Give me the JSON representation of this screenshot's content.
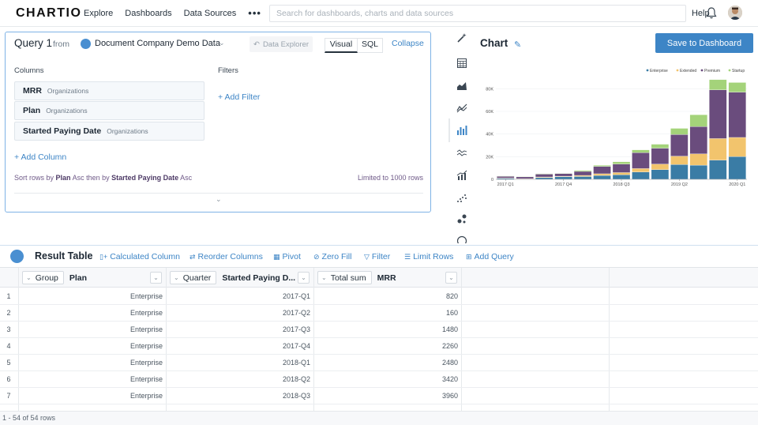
{
  "app": {
    "logo": "CHARTIO"
  },
  "nav": {
    "explore": "Explore",
    "dashboards": "Dashboards",
    "data_sources": "Data Sources",
    "more": "•••",
    "help": "Help"
  },
  "search": {
    "placeholder": "Search for dashboards, charts and data sources",
    "value": ""
  },
  "query": {
    "title": "Query 1",
    "from_label": "from",
    "data_source": "Document Company Demo Data",
    "explorer_label": "Data Explorer",
    "tabs": [
      "Visual",
      "SQL"
    ],
    "collapse_label": "Collapse",
    "columns_label": "Columns",
    "filters_label": "Filters",
    "columns": [
      {
        "name": "MRR",
        "source": "Organizations"
      },
      {
        "name": "Plan",
        "source": "Organizations"
      },
      {
        "name": "Started Paying Date",
        "source": "Organizations"
      }
    ],
    "add_column": "+ Add Column",
    "add_filter": "+ Add Filter",
    "sort_prefix": "Sort rows by",
    "sort_field_1": "Plan",
    "sort_dir_1": "Asc then by",
    "sort_field_2": "Started Paying Date",
    "sort_dir_2": "Asc",
    "limit_text": "Limited to 1000 rows"
  },
  "chart_panel": {
    "title": "Chart",
    "save_button": "Save to Dashboard"
  },
  "chart_data": {
    "type": "bar",
    "stacked": true,
    "categories": [
      "2017-Q1",
      "2017-Q2",
      "2017-Q3",
      "2017-Q4",
      "2018-Q1",
      "2018-Q2",
      "2018-Q3",
      "2018-Q4",
      "2019-Q1",
      "2019-Q2",
      "2019-Q3",
      "2019-Q4",
      "2020-Q1"
    ],
    "tick_labels": [
      "2017 Q1",
      "2017 Q4",
      "2018 Q3",
      "2019 Q2",
      "2020 Q1"
    ],
    "y_ticks": [
      "0",
      "20K",
      "40K",
      "60K",
      "80K"
    ],
    "ylim": [
      0,
      90000
    ],
    "legend_position": "top-right",
    "series": [
      {
        "name": "Enterprise",
        "color": "#3a7ca5",
        "values": [
          820,
          160,
          1480,
          2260,
          2480,
          3420,
          3960,
          6500,
          8500,
          13000,
          12500,
          17000,
          20000
        ]
      },
      {
        "name": "Extended",
        "color": "#f2c46d",
        "values": [
          300,
          400,
          600,
          500,
          1000,
          1500,
          2000,
          3000,
          5000,
          7500,
          10000,
          19000,
          17000
        ]
      },
      {
        "name": "Premium",
        "color": "#6a4c7d",
        "values": [
          1500,
          1600,
          2500,
          2300,
          3500,
          6500,
          7500,
          14000,
          14000,
          19000,
          24000,
          43000,
          40000
        ]
      },
      {
        "name": "Startup",
        "color": "#a4d37a",
        "values": [
          300,
          300,
          400,
          300,
          800,
          1000,
          2000,
          2500,
          3500,
          5500,
          10500,
          9000,
          8500
        ]
      }
    ]
  },
  "result_table": {
    "title": "Result Table",
    "tools": [
      "Calculated Column",
      "Reorder Columns",
      "Pivot",
      "Zero Fill",
      "Filter",
      "Limit Rows",
      "Add Query"
    ],
    "headers": [
      {
        "agg": "Group",
        "name": "Plan"
      },
      {
        "agg": "Quarter",
        "name": "Started Paying D..."
      },
      {
        "agg": "Total sum",
        "name": "MRR"
      }
    ],
    "rows": [
      [
        "1",
        "Enterprise",
        "2017-Q1",
        "820"
      ],
      [
        "2",
        "Enterprise",
        "2017-Q2",
        "160"
      ],
      [
        "3",
        "Enterprise",
        "2017-Q3",
        "1480"
      ],
      [
        "4",
        "Enterprise",
        "2017-Q4",
        "2260"
      ],
      [
        "5",
        "Enterprise",
        "2018-Q1",
        "2480"
      ],
      [
        "6",
        "Enterprise",
        "2018-Q2",
        "3420"
      ],
      [
        "7",
        "Enterprise",
        "2018-Q3",
        "3960"
      ]
    ],
    "status": "1 - 54 of 54 rows"
  }
}
